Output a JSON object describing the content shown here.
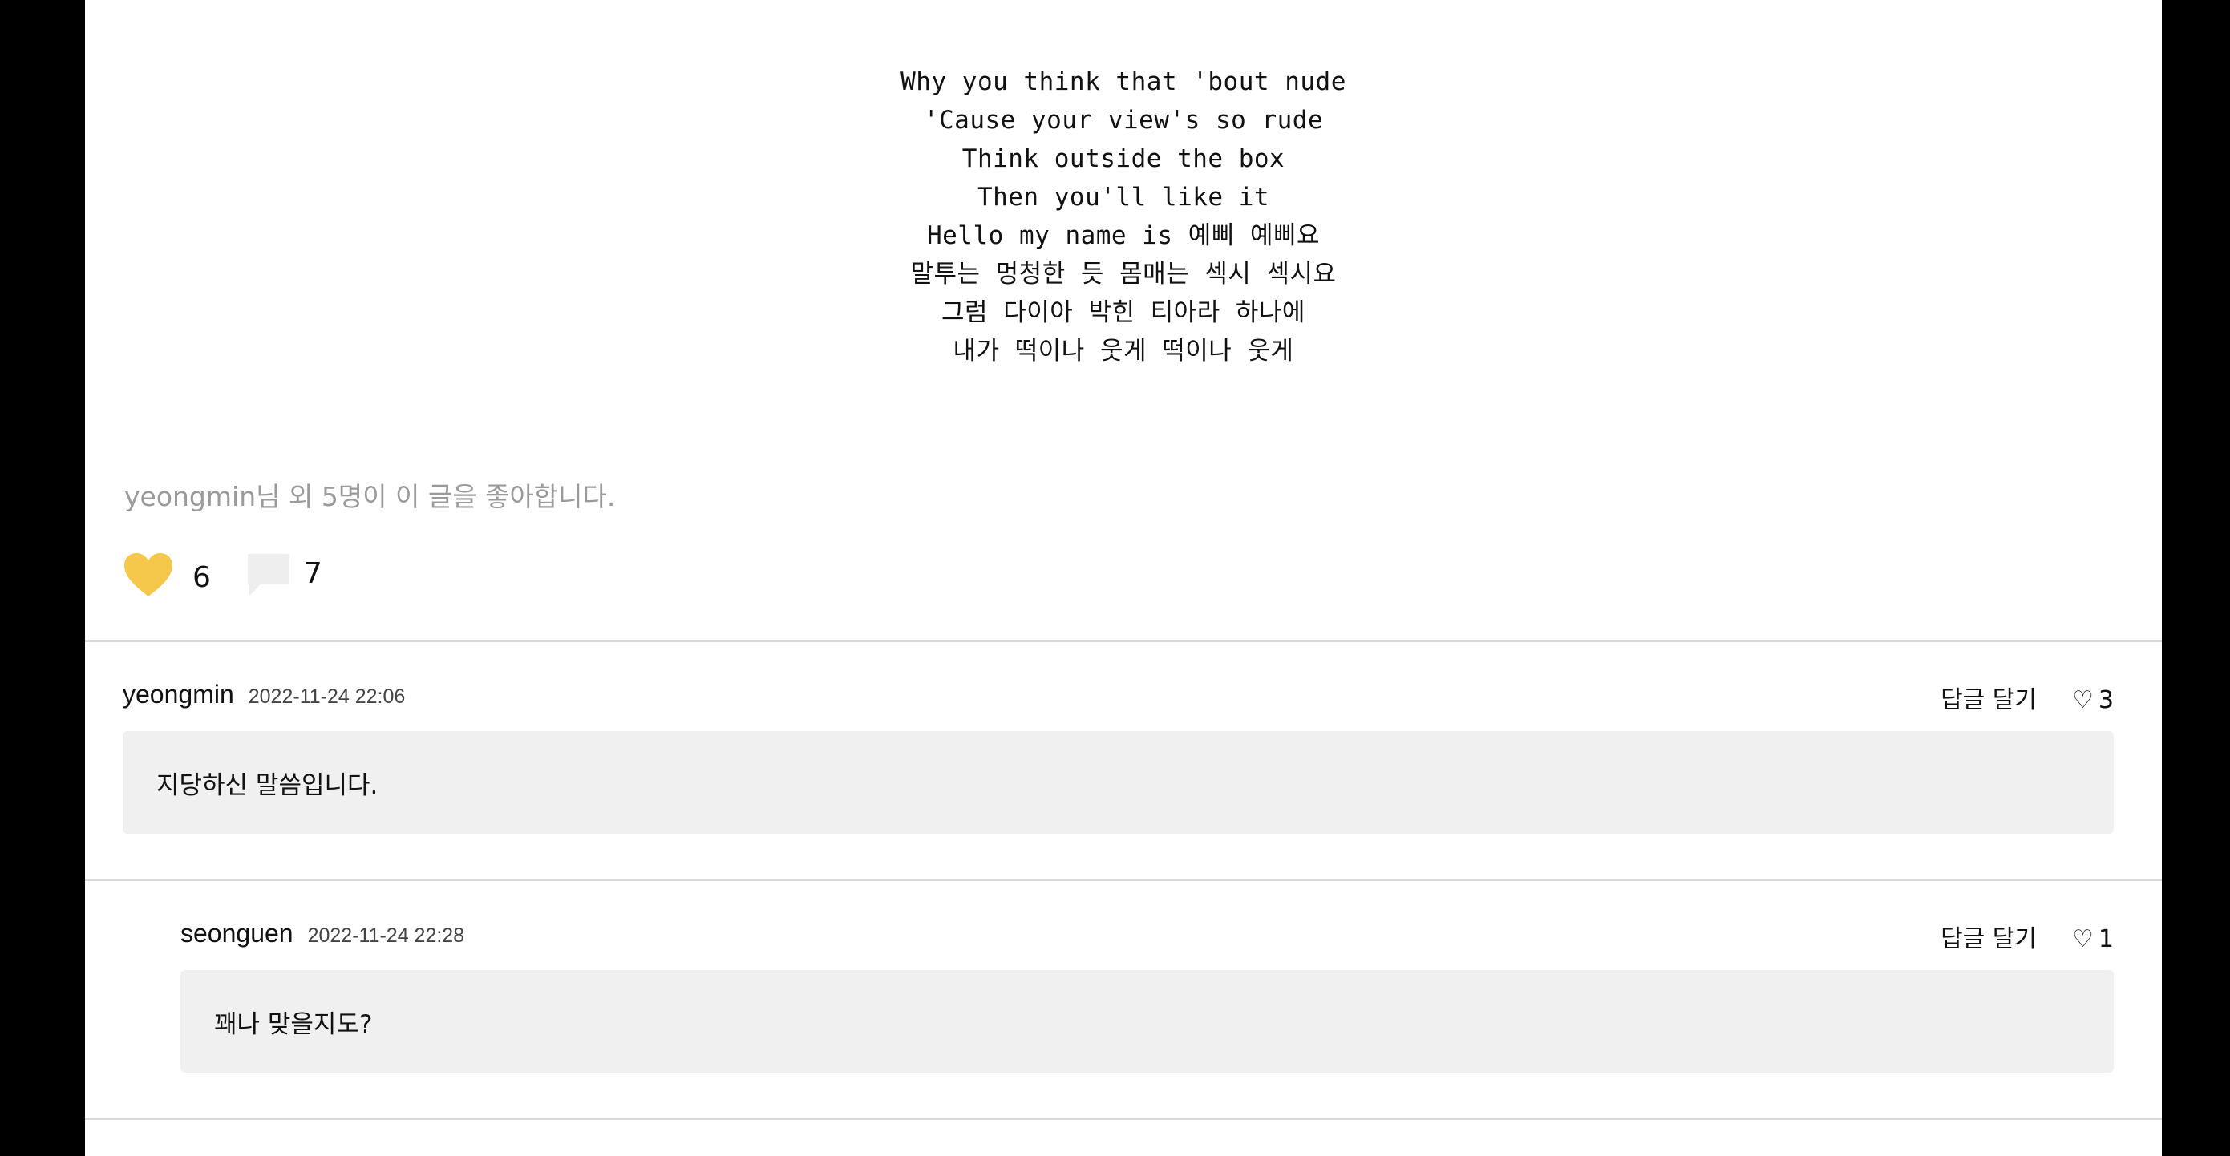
{
  "post": {
    "lyrics": [
      "Why you think that 'bout nude",
      "'Cause your view's so rude",
      "Think outside the box",
      "Then you'll like it",
      "Hello my name is 예삐 예삐요",
      "말투는 멍청한 듯 몸매는 섹시 섹시요",
      "그럼 다이아 박힌 티아라 하나에",
      "내가 떡이나 웃게 떡이나 웃게"
    ],
    "likes_summary": "yeongmin님 외 5명이 이 글을 좋아합니다.",
    "like_count": "6",
    "comment_count": "7",
    "heart_icon": "heart-icon",
    "comment_icon": "speech-bubble-icon",
    "heart_color": "#f5c84c",
    "comment_icon_color": "#eeeeee"
  },
  "comments": [
    {
      "author": "yeongmin",
      "date": "2022-11-24 22:06",
      "reply_label": "답글 달기",
      "like_symbol": "♡",
      "like_count": "3",
      "body": "지당하신 말씀입니다."
    },
    {
      "author": "seonguen",
      "date": "2022-11-24 22:28",
      "reply_label": "답글 달기",
      "like_symbol": "♡",
      "like_count": "1",
      "body": "꽤나 맞을지도?"
    }
  ]
}
